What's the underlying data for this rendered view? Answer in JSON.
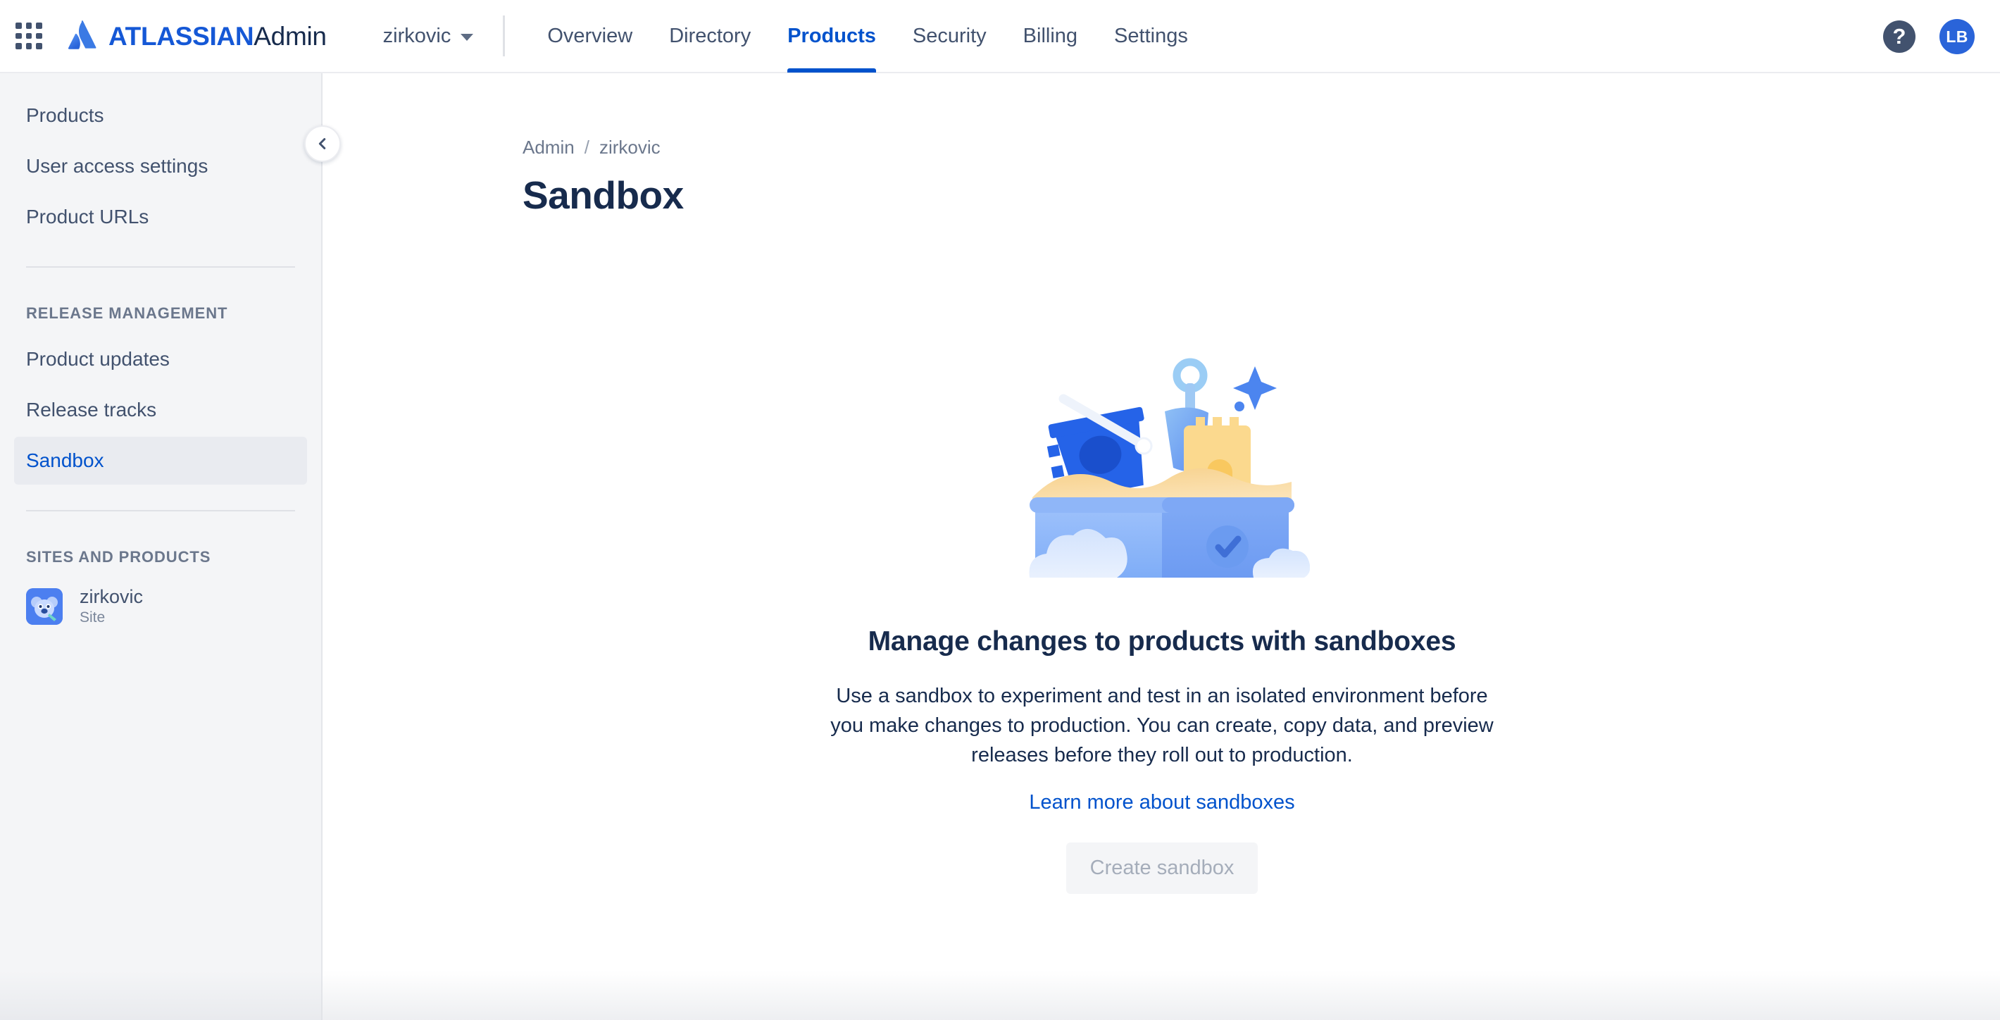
{
  "header": {
    "app_switcher_icon": "grid-apps-icon",
    "logo_icon": "atlassian-logo-icon",
    "brand_bold": "ATLASSIAN",
    "brand_regular": "Admin",
    "org_name": "zirkovic",
    "org_chevron_icon": "chevron-down-icon",
    "tabs": [
      {
        "label": "Overview",
        "active": false
      },
      {
        "label": "Directory",
        "active": false
      },
      {
        "label": "Products",
        "active": true
      },
      {
        "label": "Security",
        "active": false
      },
      {
        "label": "Billing",
        "active": false
      },
      {
        "label": "Settings",
        "active": false
      }
    ],
    "help_icon": "question-mark-icon",
    "help_label": "?",
    "avatar_initials": "LB"
  },
  "sidebar": {
    "items": [
      {
        "label": "Products",
        "active": false
      },
      {
        "label": "User access settings",
        "active": false
      },
      {
        "label": "Product URLs",
        "active": false
      }
    ],
    "release_section_heading": "RELEASE MANAGEMENT",
    "release_items": [
      {
        "label": "Product updates",
        "active": false
      },
      {
        "label": "Release tracks",
        "active": false
      },
      {
        "label": "Sandbox",
        "active": true
      }
    ],
    "sites_section_heading": "SITES AND PRODUCTS",
    "site": {
      "icon": "koala-site-icon",
      "name": "zirkovic",
      "type": "Site"
    },
    "collapse_icon": "chevron-left-icon"
  },
  "main": {
    "breadcrumb": [
      {
        "label": "Admin"
      },
      {
        "label": "zirkovic"
      }
    ],
    "breadcrumb_separator": "/",
    "page_title": "Sandbox",
    "illustration_icon": "sandbox-illustration",
    "empty_title": "Manage changes to products with sandboxes",
    "empty_body": "Use a sandbox to experiment and test in an isolated environment before you make changes to production. You can create, copy data, and preview releases before they roll out to production.",
    "learn_more_label": "Learn more about sandboxes",
    "create_button_label": "Create sandbox"
  },
  "colors": {
    "brand_blue": "#1558d6",
    "link_blue": "#0052cc",
    "text_dark": "#172b4d",
    "text_muted": "#6b778c",
    "sidebar_bg": "#f4f5f7",
    "active_item_bg": "#e9ebf0",
    "avatar_bg": "#2a64d9",
    "help_bg": "#42526e"
  }
}
